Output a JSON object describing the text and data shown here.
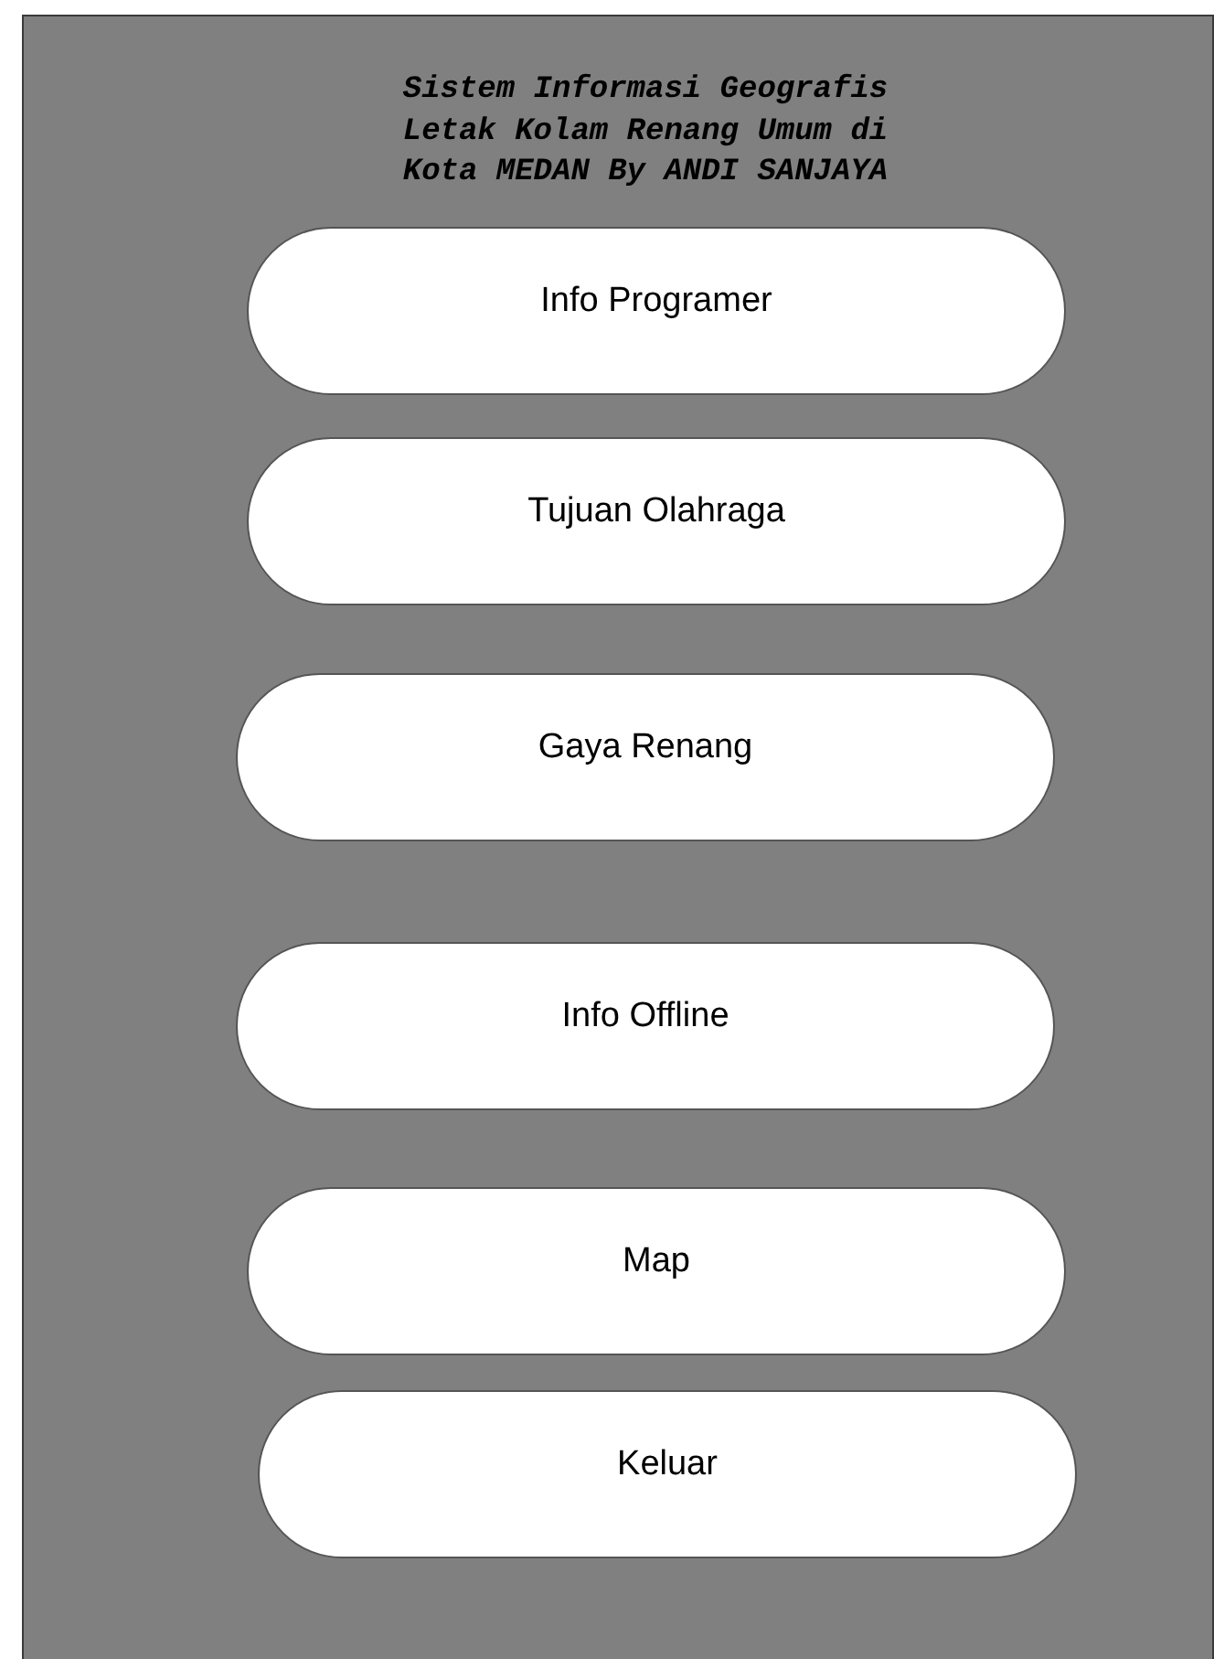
{
  "title": [
    "Sistem Informasi Geografis",
    "Letak Kolam Renang Umum di",
    "Kota MEDAN By ANDI SANJAYA"
  ],
  "buttons": [
    "Info Programer",
    "Tujuan Olahraga",
    "Gaya Renang",
    "Info Offline",
    "Map",
    "Keluar"
  ]
}
